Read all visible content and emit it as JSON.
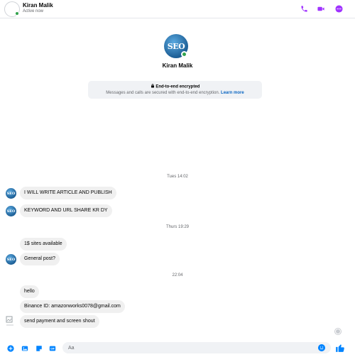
{
  "header": {
    "name": "Kiran Malik",
    "status": "Active now",
    "actions": [
      {
        "icon": "phone-icon"
      },
      {
        "icon": "video-camera-icon"
      },
      {
        "icon": "more-options-icon"
      }
    ]
  },
  "intro": {
    "avatar_logo": "SEO",
    "name": "Kiran Malik",
    "encryption_title": "End-to-end encrypted",
    "encryption_text": "Messages and calls are secured with end-to-end encryption.",
    "learn_more": "Learn more"
  },
  "timestamps": {
    "t1": "Tues 14:02",
    "t2": "Thurs 19:29",
    "t3": "22:04"
  },
  "messages": [
    {
      "text": "I WILL WRITE ARTICLE AND PUBLISH",
      "avatar": "SEO"
    },
    {
      "text": "KEYWORD AND URL SHARE KR DY",
      "avatar": "SEO"
    },
    {
      "text": "1$ sites available",
      "avatar": ""
    },
    {
      "text": "General post?",
      "avatar": "SEO"
    },
    {
      "text": "hello",
      "avatar": ""
    },
    {
      "text": "Binance ID: amazonworks0078@gmail.com",
      "avatar": ""
    },
    {
      "text": "send payment and screen shout",
      "avatar": ""
    }
  ],
  "composer": {
    "placeholder": "Aa"
  },
  "colors": {
    "accent": "#a033ff",
    "messenger_blue": "#0084ff",
    "bubble": "#f0f0f0",
    "online": "#31a24c"
  }
}
